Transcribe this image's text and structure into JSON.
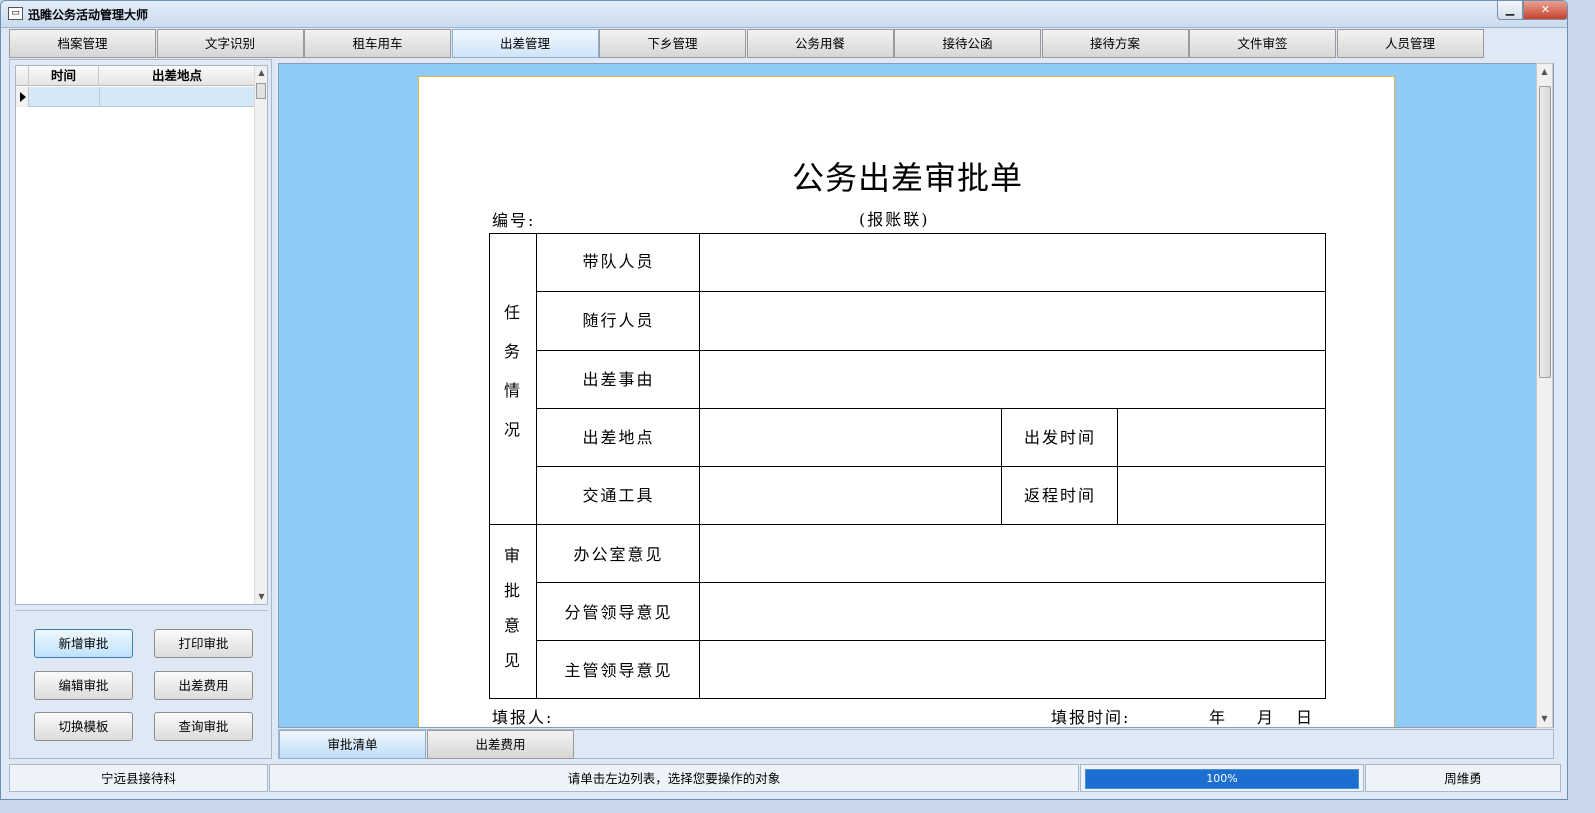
{
  "window": {
    "title": "迅睢公务活动管理大师",
    "app_icon": "window-menu-icon",
    "minimize_icon": "minimize-icon",
    "close_icon": "close-icon"
  },
  "tabs": [
    "档案管理",
    "文字识别",
    "租车用车",
    "出差管理",
    "下乡管理",
    "公务用餐",
    "接待公函",
    "接待方案",
    "文件审签",
    "人员管理"
  ],
  "active_tab": "出差管理",
  "left_panel": {
    "grid": {
      "columns": [
        "时间",
        "出差地点"
      ],
      "rows": [
        [
          "",
          ""
        ]
      ]
    },
    "buttons": {
      "new": "新增审批",
      "print": "打印审批",
      "edit": "编辑审批",
      "expense": "出差费用",
      "switch_template": "切换模板",
      "query": "查询审批"
    }
  },
  "document": {
    "title": "公务出差审批单",
    "number_label": "编号:",
    "copy_label": "(报账联)",
    "section_task": [
      "任",
      "务",
      "情",
      "况"
    ],
    "section_approval": [
      "审",
      "批",
      "意",
      "见"
    ],
    "fields": {
      "leader": "带队人员",
      "companions": "随行人员",
      "reason": "出差事由",
      "location": "出差地点",
      "depart_time": "出发时间",
      "transport": "交通工具",
      "return_time": "返程时间",
      "office_opinion": "办公室意见",
      "branch_leader_opinion": "分管领导意见",
      "chief_leader_opinion": "主管领导意见"
    },
    "filler_label": "填报人:",
    "fill_time_label": "填报时间:",
    "year": "年",
    "month": "月",
    "day": "日"
  },
  "bottom_tabs": [
    "审批清单",
    "出差费用"
  ],
  "active_bottom_tab": "审批清单",
  "status": {
    "department": "宁远县接待科",
    "message": "请单击左边列表，选择您要操作的对象",
    "progress_text": "100%",
    "progress_value": 1.0,
    "user": "周维勇"
  }
}
